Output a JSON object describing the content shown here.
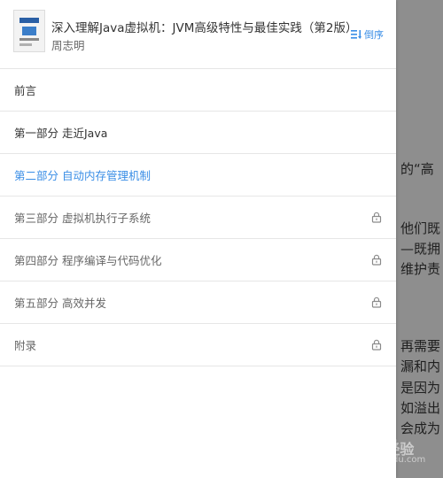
{
  "background": {
    "text_lines": [
      "的“高",
      "他们既",
      "—既拥",
      "维护责",
      "再需要",
      "漏和内",
      "是因为",
      "如溢出",
      "会成为"
    ],
    "watermark_main": "Bai’du经验",
    "watermark_sub": "jingyan.baidu.com"
  },
  "header": {
    "book_title": "深入理解Java虚拟机：JVM高级特性与最佳实践（第2版）",
    "author": "周志明",
    "sort_label": "倒序"
  },
  "toc": {
    "items": [
      {
        "label": "前言",
        "state": "normal",
        "locked": false
      },
      {
        "label": "第一部分 走近Java",
        "state": "normal",
        "locked": false
      },
      {
        "label": "第二部分 自动内存管理机制",
        "state": "active",
        "locked": false
      },
      {
        "label": "第三部分 虚拟机执行子系统",
        "state": "normal",
        "locked": true
      },
      {
        "label": "第四部分 程序编译与代码优化",
        "state": "normal",
        "locked": true
      },
      {
        "label": "第五部分 高效并发",
        "state": "normal",
        "locked": true
      },
      {
        "label": "附录",
        "state": "normal",
        "locked": true
      }
    ]
  },
  "colors": {
    "accent": "#3a8ee6",
    "overlay": "#8e8e8e",
    "text": "#333333",
    "divider": "#e6e6e6"
  }
}
